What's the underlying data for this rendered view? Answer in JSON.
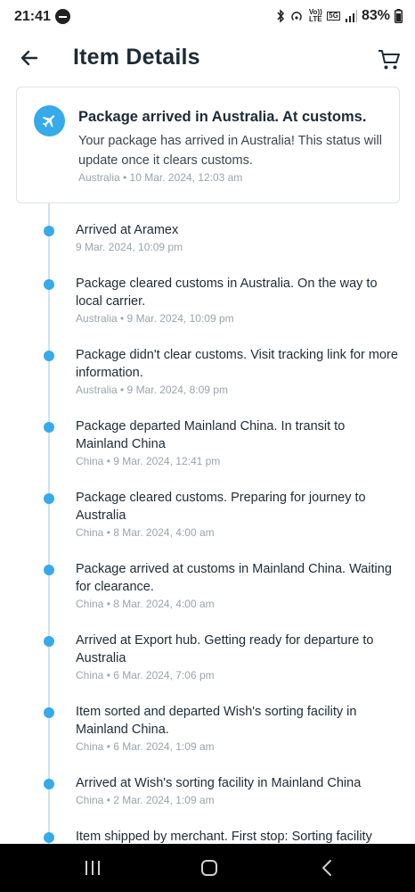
{
  "status_bar": {
    "time": "21:41",
    "volte_label": "Vo)) LTE",
    "network_label": "5G",
    "battery": "83%"
  },
  "header": {
    "title": "Item Details"
  },
  "status_card": {
    "title": "Package arrived in Australia. At customs.",
    "description": "Your package has arrived in Australia! This status will update once it clears customs.",
    "meta": "Australia • 10 Mar. 2024, 12:03 am"
  },
  "events": [
    {
      "title": "Arrived at Aramex",
      "meta": "9 Mar. 2024, 10:09 pm"
    },
    {
      "title": "Package cleared customs in Australia. On the way to local carrier.",
      "meta": "Australia • 9 Mar. 2024, 10:09 pm"
    },
    {
      "title": "Package didn't clear customs. Visit tracking link for more information.",
      "meta": "Australia • 9 Mar. 2024, 8:09 pm"
    },
    {
      "title": "Package departed Mainland China. In transit to Mainland China",
      "meta": "China • 9 Mar. 2024, 12:41 pm"
    },
    {
      "title": "Package cleared customs. Preparing for journey to Australia",
      "meta": "China • 8 Mar. 2024, 4:00 am"
    },
    {
      "title": "Package arrived at customs in Mainland China. Waiting for clearance.",
      "meta": "China • 8 Mar. 2024, 4:00 am"
    },
    {
      "title": "Arrived at Export hub. Getting ready for departure to Australia",
      "meta": "China • 6 Mar. 2024, 7:06 pm"
    },
    {
      "title": "Item sorted and departed Wish's sorting facility in Mainland China.",
      "meta": "China • 6 Mar. 2024, 1:09 am"
    },
    {
      "title": "Arrived at Wish's sorting facility in Mainland China",
      "meta": "China • 2 Mar. 2024, 1:09 am"
    },
    {
      "title": "Item shipped by merchant. First stop: Sorting facility",
      "meta": ""
    }
  ],
  "colors": {
    "accent": "#36aaea",
    "text": "#1d2b36",
    "meta": "#9aa4ab"
  },
  "icons": [
    "back-arrow-icon",
    "cart-icon",
    "plane-icon",
    "bluetooth-icon",
    "signal-icon",
    "battery-icon"
  ]
}
